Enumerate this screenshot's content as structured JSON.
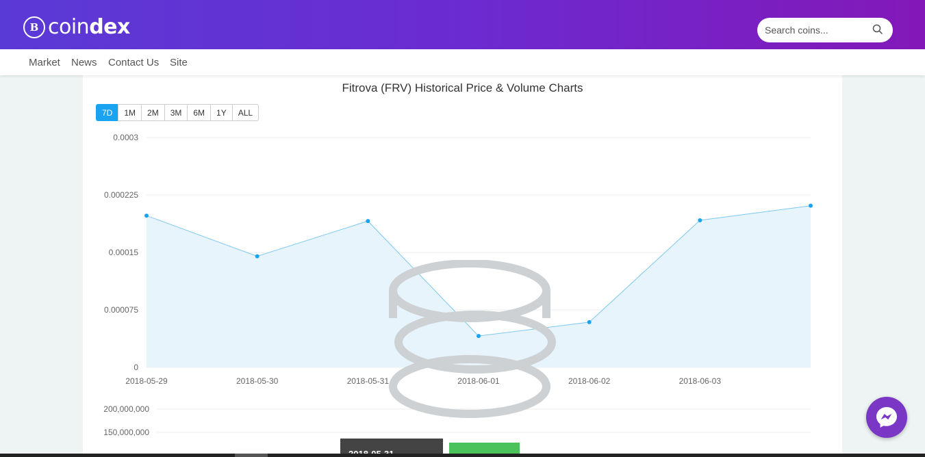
{
  "header": {
    "logo_mark": "B",
    "logo_text_light": "coin",
    "logo_text_bold": "dex",
    "search_placeholder": "Search coins...",
    "search_icon": "search-icon"
  },
  "nav": {
    "items": [
      {
        "label": "Market"
      },
      {
        "label": "News"
      },
      {
        "label": "Contact Us"
      },
      {
        "label": "Site"
      }
    ]
  },
  "chart_section": {
    "title": "Fitrova (FRV) Historical Price & Volume Charts",
    "ranges": [
      "7D",
      "1M",
      "2M",
      "3M",
      "6M",
      "1Y",
      "ALL"
    ],
    "active_range": "7D"
  },
  "chart_data": [
    {
      "type": "area",
      "title": "Fitrova (FRV) Historical Price & Volume Charts",
      "x_ticks": [
        "2018-05-29",
        "2018-05-30",
        "2018-05-31",
        "2018-06-01",
        "2018-06-02",
        "2018-06-03"
      ],
      "y_ticks": [
        "0",
        "0.000075",
        "0.00015",
        "0.000225",
        "0.0003"
      ],
      "ylim": [
        0,
        0.0003
      ],
      "points": [
        {
          "x": "2018-05-29",
          "y": 0.000198
        },
        {
          "x": "2018-05-30",
          "y": 0.000145
        },
        {
          "x": "2018-05-31",
          "y": 0.000191
        },
        {
          "x": "2018-06-01",
          "y": 4.1e-05
        },
        {
          "x": "2018-06-02",
          "y": 5.9e-05
        },
        {
          "x": "2018-06-03",
          "y": 0.000192
        },
        {
          "x": "2018-06-04",
          "y": 0.000211
        }
      ],
      "line_color": "#7cc8f0",
      "fill_color": "#e8f4fc",
      "point_color": "#1aa3f0",
      "grid": true
    },
    {
      "type": "bar",
      "y_ticks": [
        "200,000,000",
        "150,000,000"
      ],
      "bar_color": "#4cc35a"
    }
  ],
  "tooltip": {
    "text": "2018-05-31"
  },
  "colors": {
    "header_start": "#5a3ad6",
    "header_end": "#8318b8",
    "accent": "#1aa3f0",
    "messenger": "#7a37c6"
  },
  "messenger": {
    "icon": "messenger-icon"
  }
}
